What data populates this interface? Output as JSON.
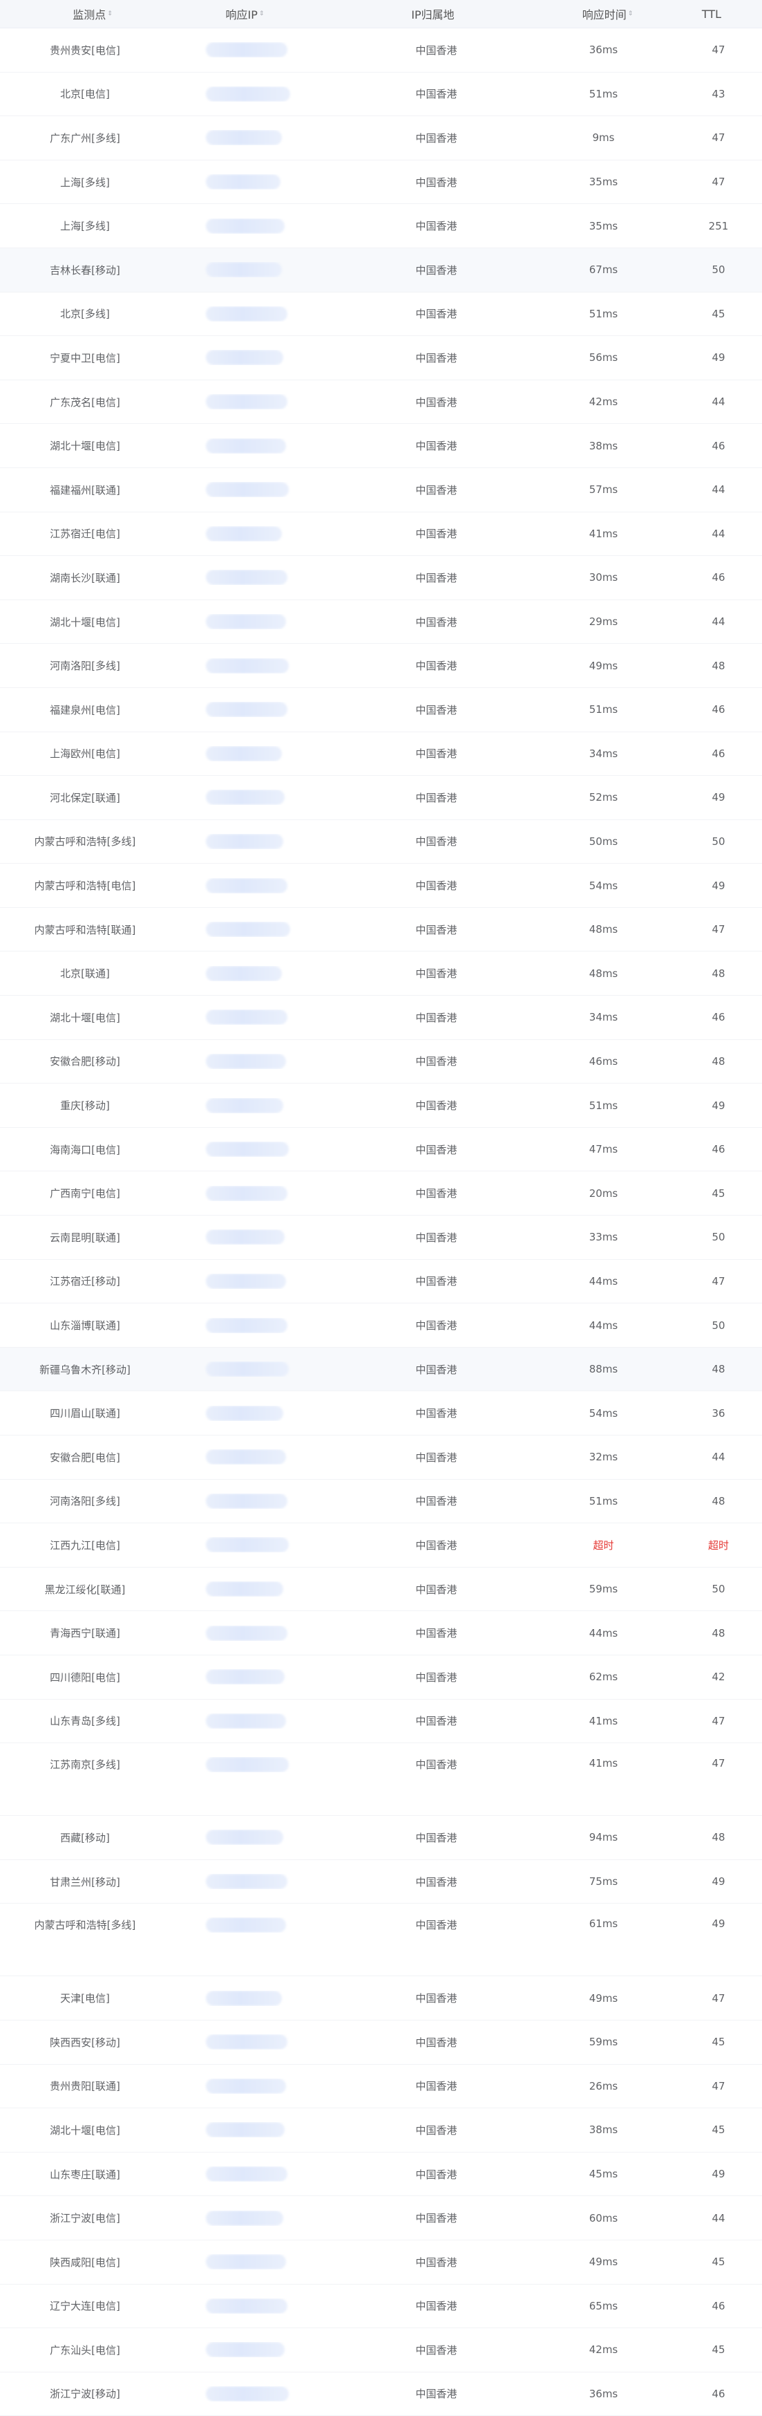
{
  "header": {
    "node": "监测点",
    "ip": "响应IP",
    "location": "IP归属地",
    "time": "响应时间",
    "ttl": "TTL"
  },
  "rows": [
    {
      "node": "贵州贵安[电信]",
      "location": "中国香港",
      "time": "36ms",
      "ttl": "47"
    },
    {
      "node": "北京[电信]",
      "location": "中国香港",
      "time": "51ms",
      "ttl": "43"
    },
    {
      "node": "广东广州[多线]",
      "location": "中国香港",
      "time": "9ms",
      "ttl": "47"
    },
    {
      "node": "上海[多线]",
      "location": "中国香港",
      "time": "35ms",
      "ttl": "47"
    },
    {
      "node": "上海[多线]",
      "location": "中国香港",
      "time": "35ms",
      "ttl": "251"
    },
    {
      "node": "吉林长春[移动]",
      "location": "中国香港",
      "time": "67ms",
      "ttl": "50"
    },
    {
      "node": "北京[多线]",
      "location": "中国香港",
      "time": "51ms",
      "ttl": "45"
    },
    {
      "node": "宁夏中卫[电信]",
      "location": "中国香港",
      "time": "56ms",
      "ttl": "49"
    },
    {
      "node": "广东茂名[电信]",
      "location": "中国香港",
      "time": "42ms",
      "ttl": "44"
    },
    {
      "node": "湖北十堰[电信]",
      "location": "中国香港",
      "time": "38ms",
      "ttl": "46"
    },
    {
      "node": "福建福州[联通]",
      "location": "中国香港",
      "time": "57ms",
      "ttl": "44"
    },
    {
      "node": "江苏宿迁[电信]",
      "location": "中国香港",
      "time": "41ms",
      "ttl": "44"
    },
    {
      "node": "湖南长沙[联通]",
      "location": "中国香港",
      "time": "30ms",
      "ttl": "46"
    },
    {
      "node": "湖北十堰[电信]",
      "location": "中国香港",
      "time": "29ms",
      "ttl": "44"
    },
    {
      "node": "河南洛阳[多线]",
      "location": "中国香港",
      "time": "49ms",
      "ttl": "48"
    },
    {
      "node": "福建泉州[电信]",
      "location": "中国香港",
      "time": "51ms",
      "ttl": "46"
    },
    {
      "node": "上海欧州[电信]",
      "location": "中国香港",
      "time": "34ms",
      "ttl": "46"
    },
    {
      "node": "河北保定[联通]",
      "location": "中国香港",
      "time": "52ms",
      "ttl": "49"
    },
    {
      "node": "内蒙古呼和浩特[多线]",
      "location": "中国香港",
      "time": "50ms",
      "ttl": "50"
    },
    {
      "node": "内蒙古呼和浩特[电信]",
      "location": "中国香港",
      "time": "54ms",
      "ttl": "49"
    },
    {
      "node": "内蒙古呼和浩特[联通]",
      "location": "中国香港",
      "time": "48ms",
      "ttl": "47"
    },
    {
      "node": "北京[联通]",
      "location": "中国香港",
      "time": "48ms",
      "ttl": "48"
    },
    {
      "node": "湖北十堰[电信]",
      "location": "中国香港",
      "time": "34ms",
      "ttl": "46"
    },
    {
      "node": "安徽合肥[移动]",
      "location": "中国香港",
      "time": "46ms",
      "ttl": "48"
    },
    {
      "node": "重庆[移动]",
      "location": "中国香港",
      "time": "51ms",
      "ttl": "49"
    },
    {
      "node": "海南海口[电信]",
      "location": "中国香港",
      "time": "47ms",
      "ttl": "46"
    },
    {
      "node": "广西南宁[电信]",
      "location": "中国香港",
      "time": "20ms",
      "ttl": "45"
    },
    {
      "node": "云南昆明[联通]",
      "location": "中国香港",
      "time": "33ms",
      "ttl": "50"
    },
    {
      "node": "江苏宿迁[移动]",
      "location": "中国香港",
      "time": "44ms",
      "ttl": "47"
    },
    {
      "node": "山东淄博[联通]",
      "location": "中国香港",
      "time": "44ms",
      "ttl": "50"
    },
    {
      "node": "新疆乌鲁木齐[移动]",
      "location": "中国香港",
      "time": "88ms",
      "ttl": "48"
    },
    {
      "node": "四川眉山[联通]",
      "location": "中国香港",
      "time": "54ms",
      "ttl": "36"
    },
    {
      "node": "安徽合肥[电信]",
      "location": "中国香港",
      "time": "32ms",
      "ttl": "44"
    },
    {
      "node": "河南洛阳[多线]",
      "location": "中国香港",
      "time": "51ms",
      "ttl": "48"
    },
    {
      "node": "江西九江[电信]",
      "location": "中国香港",
      "time": "超时",
      "ttl": "超时"
    },
    {
      "node": "黑龙江绥化[联通]",
      "location": "中国香港",
      "time": "59ms",
      "ttl": "50"
    },
    {
      "node": "青海西宁[联通]",
      "location": "中国香港",
      "time": "44ms",
      "ttl": "48"
    },
    {
      "node": "四川德阳[电信]",
      "location": "中国香港",
      "time": "62ms",
      "ttl": "42"
    },
    {
      "node": "山东青岛[多线]",
      "location": "中国香港",
      "time": "41ms",
      "ttl": "47"
    },
    {
      "node": "江苏南京[多线]",
      "location": "中国香港",
      "time": "41ms",
      "ttl": "47"
    },
    {
      "node": "西藏[移动]",
      "location": "中国香港",
      "time": "94ms",
      "ttl": "48"
    },
    {
      "node": "甘肃兰州[移动]",
      "location": "中国香港",
      "time": "75ms",
      "ttl": "49"
    },
    {
      "node": "内蒙古呼和浩特[多线]",
      "location": "中国香港",
      "time": "61ms",
      "ttl": "49"
    },
    {
      "node": "天津[电信]",
      "location": "中国香港",
      "time": "49ms",
      "ttl": "47"
    },
    {
      "node": "陕西西安[移动]",
      "location": "中国香港",
      "time": "59ms",
      "ttl": "45"
    },
    {
      "node": "贵州贵阳[联通]",
      "location": "中国香港",
      "time": "26ms",
      "ttl": "47"
    },
    {
      "node": "湖北十堰[电信]",
      "location": "中国香港",
      "time": "38ms",
      "ttl": "45"
    },
    {
      "node": "山东枣庄[联通]",
      "location": "中国香港",
      "time": "45ms",
      "ttl": "49"
    },
    {
      "node": "浙江宁波[电信]",
      "location": "中国香港",
      "time": "60ms",
      "ttl": "44"
    },
    {
      "node": "陕西咸阳[电信]",
      "location": "中国香港",
      "time": "49ms",
      "ttl": "45"
    },
    {
      "node": "辽宁大连[电信]",
      "location": "中国香港",
      "time": "65ms",
      "ttl": "46"
    },
    {
      "node": "广东汕头[电信]",
      "location": "中国香港",
      "time": "42ms",
      "ttl": "45"
    },
    {
      "node": "浙江宁波[移动]",
      "location": "中国香港",
      "time": "36ms",
      "ttl": "46"
    }
  ]
}
